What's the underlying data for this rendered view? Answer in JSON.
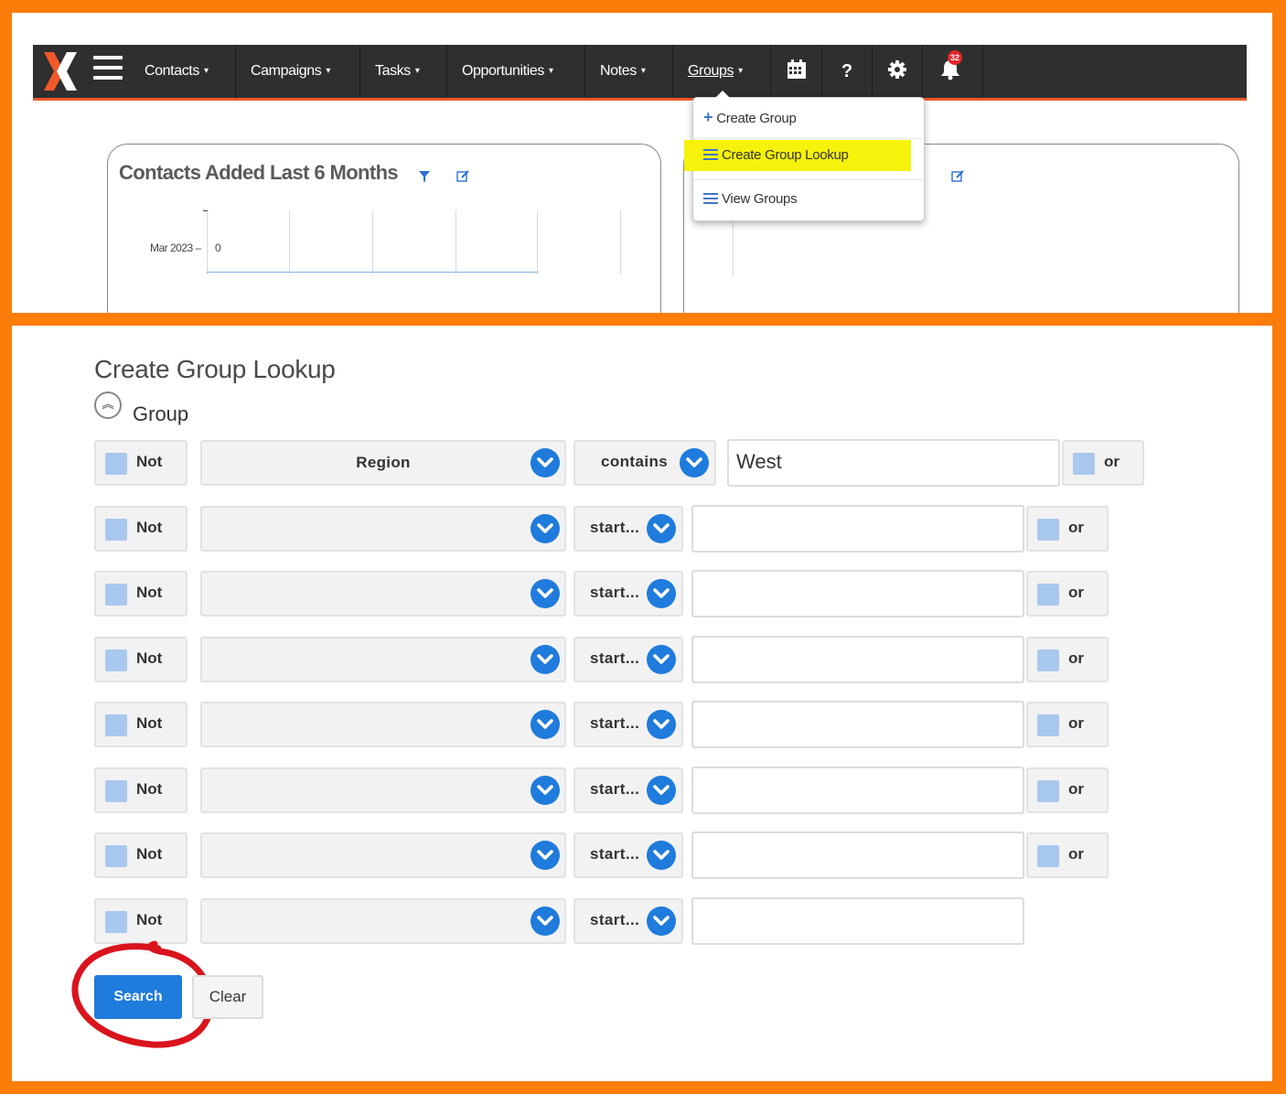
{
  "navbar": {
    "items": [
      {
        "label": "Contacts"
      },
      {
        "label": "Campaigns"
      },
      {
        "label": "Tasks"
      },
      {
        "label": "Opportunities"
      },
      {
        "label": "Notes"
      },
      {
        "label": "Groups"
      }
    ],
    "caret": "▾",
    "notification_count": "32"
  },
  "groups_menu": {
    "items": [
      {
        "label": "Create Group",
        "icon": "plus-icon"
      },
      {
        "label": "Create Group Lookup",
        "icon": "list-icon"
      },
      {
        "label": "View Groups",
        "icon": "list-icon"
      }
    ]
  },
  "dashboard": {
    "card_title": "Contacts Added Last 6 Months",
    "tick_label": "Mar 2023 –",
    "value_label": "0"
  },
  "form": {
    "title": "Create Group Lookup",
    "section_label": "Group",
    "not_label": "Not",
    "or_label": "or",
    "rows": [
      {
        "field": "Region",
        "operator": "contains",
        "value": "West"
      },
      {
        "field": "",
        "operator": "start...",
        "value": ""
      },
      {
        "field": "",
        "operator": "start...",
        "value": ""
      },
      {
        "field": "",
        "operator": "start...",
        "value": ""
      },
      {
        "field": "",
        "operator": "start...",
        "value": ""
      },
      {
        "field": "",
        "operator": "start...",
        "value": ""
      },
      {
        "field": "",
        "operator": "start...",
        "value": ""
      },
      {
        "field": "",
        "operator": "start...",
        "value": ""
      }
    ],
    "search_label": "Search",
    "clear_label": "Clear"
  },
  "colors": {
    "frame": "#fb7d0a",
    "navbar": "#2f2f2f",
    "accent_blue": "#1f7bdc",
    "highlight": "#f6f20c",
    "annotation": "#d9141d"
  }
}
